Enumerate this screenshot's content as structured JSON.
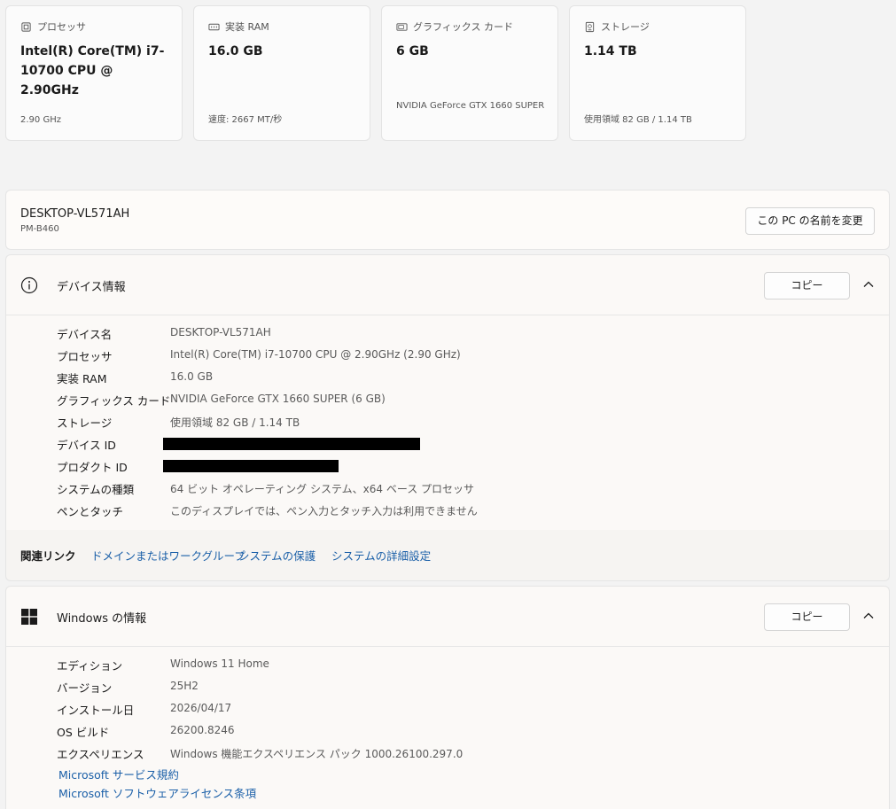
{
  "cards": [
    {
      "icon": "cpu-icon",
      "label": "プロセッサ",
      "value": "Intel(R) Core(TM) i7-10700 CPU @ 2.90GHz",
      "sub": "2.90 GHz"
    },
    {
      "icon": "ram-icon",
      "label": "実装 RAM",
      "value": "16.0 GB",
      "sub": "速度: 2667 MT/秒"
    },
    {
      "icon": "gpu-icon",
      "label": "グラフィックス カード",
      "value": "6 GB",
      "sub": "NVIDIA GeForce GTX 1660 SUPER"
    },
    {
      "icon": "storage-icon",
      "label": "ストレージ",
      "value": "1.14 TB",
      "sub": "使用領域 82 GB / 1.14 TB"
    }
  ],
  "pc": {
    "name": "DESKTOP-VL571AH",
    "model": "PM-B460",
    "rename_label": "この PC の名前を変更"
  },
  "device_info": {
    "title": "デバイス情報",
    "copy_label": "コピー",
    "rows": [
      {
        "key": "デバイス名",
        "value": "DESKTOP-VL571AH"
      },
      {
        "key": "プロセッサ",
        "value": "Intel(R) Core(TM) i7-10700 CPU @ 2.90GHz (2.90 GHz)"
      },
      {
        "key": "実装 RAM",
        "value": "16.0 GB"
      },
      {
        "key": "グラフィックス カード",
        "value": "NVIDIA GeForce GTX 1660 SUPER (6 GB)"
      },
      {
        "key": "ストレージ",
        "value": "使用領域 82 GB / 1.14 TB"
      },
      {
        "key": "デバイス ID",
        "value": ""
      },
      {
        "key": "プロダクト ID",
        "value": ""
      },
      {
        "key": "システムの種類",
        "value": "64 ビット オペレーティング システム、x64 ベース プロセッサ"
      },
      {
        "key": "ペンとタッチ",
        "value": "このディスプレイでは、ペン入力とタッチ入力は利用できません"
      }
    ]
  },
  "related": {
    "label": "関連リンク",
    "links": [
      "ドメインまたはワークグループ",
      "システムの保護",
      "システムの詳細設定"
    ]
  },
  "windows_info": {
    "title": "Windows の情報",
    "copy_label": "コピー",
    "rows": [
      {
        "key": "エディション",
        "value": "Windows 11 Home"
      },
      {
        "key": "バージョン",
        "value": "25H2"
      },
      {
        "key": "インストール日",
        "value": "2026/04/17"
      },
      {
        "key": "OS ビルド",
        "value": "26200.8246"
      },
      {
        "key": "エクスペリエンス",
        "value": "Windows 機能エクスペリエンス パック 1000.26100.297.0"
      }
    ],
    "links": [
      "Microsoft サービス規約",
      "Microsoft ソフトウェアライセンス条項"
    ]
  }
}
